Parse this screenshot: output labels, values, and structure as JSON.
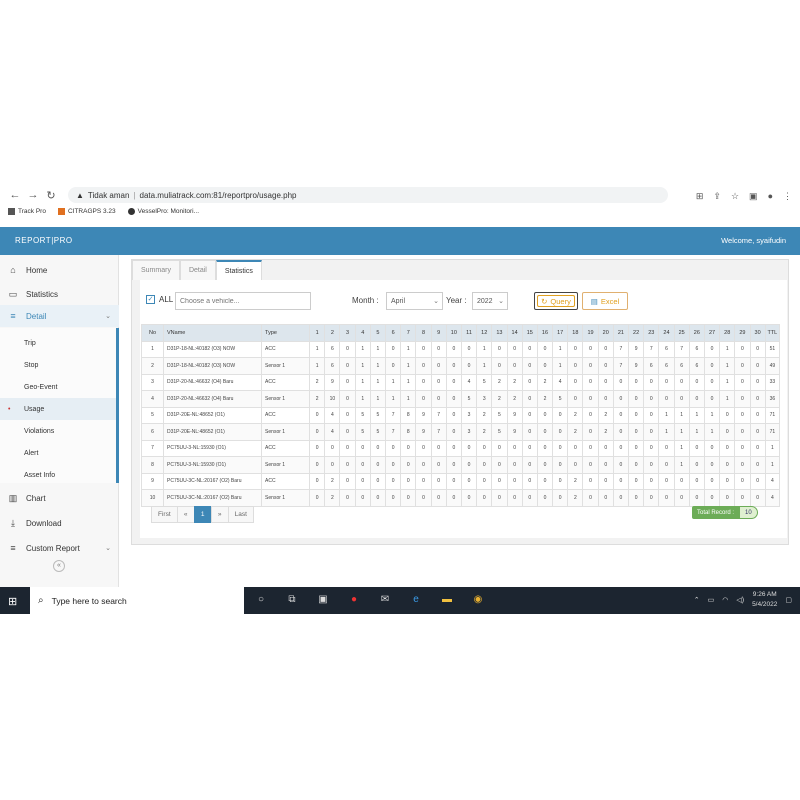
{
  "browser": {
    "security": "Tidak aman",
    "url": "data.muliatrack.com:81/reportpro/usage.php",
    "bookmarks": [
      "Track Pro",
      "CITRAGPS 3.23",
      "VesselPro: Monitori..."
    ]
  },
  "header": {
    "logo": "REPORT|PRO",
    "welcome": "Welcome, syaifudin"
  },
  "sidebar": {
    "items": [
      {
        "label": "Home",
        "icon": "home-icon"
      },
      {
        "label": "Statistics",
        "icon": "monitor-icon"
      },
      {
        "label": "Detail",
        "icon": "list-icon"
      }
    ],
    "sub_items": [
      "Trip",
      "Stop",
      "Geo-Event",
      "Usage",
      "Violations",
      "Alert",
      "Asset Info"
    ],
    "bottom_items": [
      {
        "label": "Chart",
        "icon": "bar-chart-icon"
      },
      {
        "label": "Download",
        "icon": "download-icon"
      },
      {
        "label": "Custom Report",
        "icon": "menu-icon"
      }
    ]
  },
  "tabs": [
    "Summary",
    "Detail",
    "Statistics"
  ],
  "filters": {
    "all_label": "ALL",
    "vehicle_placeholder": "Choose a vehicle...",
    "month_label": "Month :",
    "month_value": "April",
    "year_label": "Year :",
    "year_value": "2022",
    "query_label": "Query",
    "excel_label": "Excel"
  },
  "table": {
    "headers": [
      "No",
      "VName",
      "Type",
      "1",
      "2",
      "3",
      "4",
      "5",
      "6",
      "7",
      "8",
      "9",
      "10",
      "11",
      "12",
      "13",
      "14",
      "15",
      "16",
      "17",
      "18",
      "19",
      "20",
      "21",
      "22",
      "23",
      "24",
      "25",
      "26",
      "27",
      "28",
      "29",
      "30",
      "TTL"
    ],
    "rows": [
      [
        "1",
        "D31P-18-NL:40182 (O3) NOW",
        "ACC",
        "1",
        "6",
        "0",
        "1",
        "1",
        "0",
        "1",
        "0",
        "0",
        "0",
        "0",
        "1",
        "0",
        "0",
        "0",
        "0",
        "1",
        "0",
        "0",
        "0",
        "7",
        "9",
        "7",
        "6",
        "7",
        "6",
        "0",
        "1",
        "0",
        "0",
        "51"
      ],
      [
        "2",
        "D31P-18-NL:40182 (O3) NOW",
        "Sensor 1",
        "1",
        "6",
        "0",
        "1",
        "1",
        "0",
        "1",
        "0",
        "0",
        "0",
        "0",
        "1",
        "0",
        "0",
        "0",
        "0",
        "1",
        "0",
        "0",
        "0",
        "7",
        "9",
        "6",
        "6",
        "6",
        "6",
        "0",
        "1",
        "0",
        "0",
        "49"
      ],
      [
        "3",
        "D31P-20-NL:46632 (O4) Baru",
        "ACC",
        "2",
        "9",
        "0",
        "1",
        "1",
        "1",
        "1",
        "0",
        "0",
        "0",
        "4",
        "5",
        "2",
        "2",
        "0",
        "2",
        "4",
        "0",
        "0",
        "0",
        "0",
        "0",
        "0",
        "0",
        "0",
        "0",
        "0",
        "1",
        "0",
        "0",
        "33"
      ],
      [
        "4",
        "D31P-20-NL:46632 (O4) Baru",
        "Sensor 1",
        "2",
        "10",
        "0",
        "1",
        "1",
        "1",
        "1",
        "0",
        "0",
        "0",
        "5",
        "3",
        "2",
        "2",
        "0",
        "2",
        "5",
        "0",
        "0",
        "0",
        "0",
        "0",
        "0",
        "0",
        "0",
        "0",
        "0",
        "1",
        "0",
        "0",
        "36"
      ],
      [
        "5",
        "D31P-20E-NL:48652 (O1)",
        "ACC",
        "0",
        "4",
        "0",
        "5",
        "5",
        "7",
        "8",
        "9",
        "7",
        "0",
        "3",
        "2",
        "5",
        "9",
        "0",
        "0",
        "0",
        "2",
        "0",
        "2",
        "0",
        "0",
        "0",
        "1",
        "1",
        "1",
        "1",
        "0",
        "0",
        "0",
        "71"
      ],
      [
        "6",
        "D31P-20E-NL:48652 (O1)",
        "Sensor 1",
        "0",
        "4",
        "0",
        "5",
        "5",
        "7",
        "8",
        "9",
        "7",
        "0",
        "3",
        "2",
        "5",
        "9",
        "0",
        "0",
        "0",
        "2",
        "0",
        "2",
        "0",
        "0",
        "0",
        "1",
        "1",
        "1",
        "1",
        "0",
        "0",
        "0",
        "71"
      ],
      [
        "7",
        "PC75UU-3-NL:15930 (O1)",
        "ACC",
        "0",
        "0",
        "0",
        "0",
        "0",
        "0",
        "0",
        "0",
        "0",
        "0",
        "0",
        "0",
        "0",
        "0",
        "0",
        "0",
        "0",
        "0",
        "0",
        "0",
        "0",
        "0",
        "0",
        "0",
        "1",
        "0",
        "0",
        "0",
        "0",
        "0",
        "1"
      ],
      [
        "8",
        "PC75UU-3-NL:15930 (O1)",
        "Sensor 1",
        "0",
        "0",
        "0",
        "0",
        "0",
        "0",
        "0",
        "0",
        "0",
        "0",
        "0",
        "0",
        "0",
        "0",
        "0",
        "0",
        "0",
        "0",
        "0",
        "0",
        "0",
        "0",
        "0",
        "0",
        "1",
        "0",
        "0",
        "0",
        "0",
        "0",
        "1"
      ],
      [
        "9",
        "PC75UU-3C-NL:20167 (O2) Baru",
        "ACC",
        "0",
        "2",
        "0",
        "0",
        "0",
        "0",
        "0",
        "0",
        "0",
        "0",
        "0",
        "0",
        "0",
        "0",
        "0",
        "0",
        "0",
        "2",
        "0",
        "0",
        "0",
        "0",
        "0",
        "0",
        "0",
        "0",
        "0",
        "0",
        "0",
        "0",
        "4"
      ],
      [
        "10",
        "PC75UU-3C-NL:20167 (O2) Baru",
        "Sensor 1",
        "0",
        "2",
        "0",
        "0",
        "0",
        "0",
        "0",
        "0",
        "0",
        "0",
        "0",
        "0",
        "0",
        "0",
        "0",
        "0",
        "0",
        "2",
        "0",
        "0",
        "0",
        "0",
        "0",
        "0",
        "0",
        "0",
        "0",
        "0",
        "0",
        "0",
        "4"
      ]
    ]
  },
  "pagination": {
    "first": "First",
    "prev": "«",
    "current": "1",
    "next": "»",
    "last": "Last"
  },
  "total_record": {
    "label": "Total Record :",
    "value": "10"
  },
  "taskbar": {
    "search_placeholder": "Type here to search",
    "time": "9:26 AM",
    "date": "5/4/2022"
  },
  "colors": {
    "header": "#3d87b6",
    "query": "#e0a020",
    "total": "#6cac57"
  }
}
